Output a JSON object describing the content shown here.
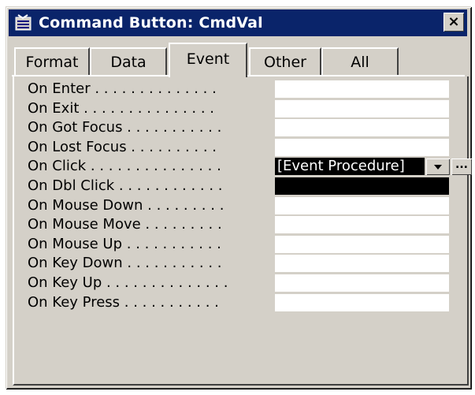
{
  "window": {
    "title": "Command Button: CmdVal",
    "close_glyph": "×"
  },
  "tabs": [
    {
      "label": "Format",
      "active": false
    },
    {
      "label": "Data",
      "active": false
    },
    {
      "label": "Event",
      "active": true
    },
    {
      "label": "Other",
      "active": false
    },
    {
      "label": "All",
      "active": false
    }
  ],
  "properties": [
    {
      "label": "On Enter . . . . . . . . . . . . . .",
      "value": ""
    },
    {
      "label": "On Exit . . . . . . . . . . . . . . .",
      "value": ""
    },
    {
      "label": "On Got Focus . . . . . . . . . . .",
      "value": ""
    },
    {
      "label": "On Lost Focus . . . . . . . . . .",
      "value": ""
    },
    {
      "label": "On Click . . . . . . . . . . . . . . .",
      "value": "[Event Procedure]"
    },
    {
      "label": "On Dbl Click . . . . . . . . . . . .",
      "value": ""
    },
    {
      "label": "On Mouse Down . . . . . . . . .",
      "value": ""
    },
    {
      "label": "On Mouse Move . . . . . . . . .",
      "value": ""
    },
    {
      "label": "On Mouse Up . . . . . . . . . . .",
      "value": ""
    },
    {
      "label": "On Key Down . . . . . . . . . . .",
      "value": ""
    },
    {
      "label": "On Key Up . . . . . . . . . . . . . .",
      "value": ""
    },
    {
      "label": "On Key Press . . . . . . . . . . .",
      "value": ""
    }
  ],
  "build_button_label": "...",
  "colors": {
    "titlebar": "#0a246a",
    "face": "#d4d0c8",
    "highlight": "#000000"
  }
}
